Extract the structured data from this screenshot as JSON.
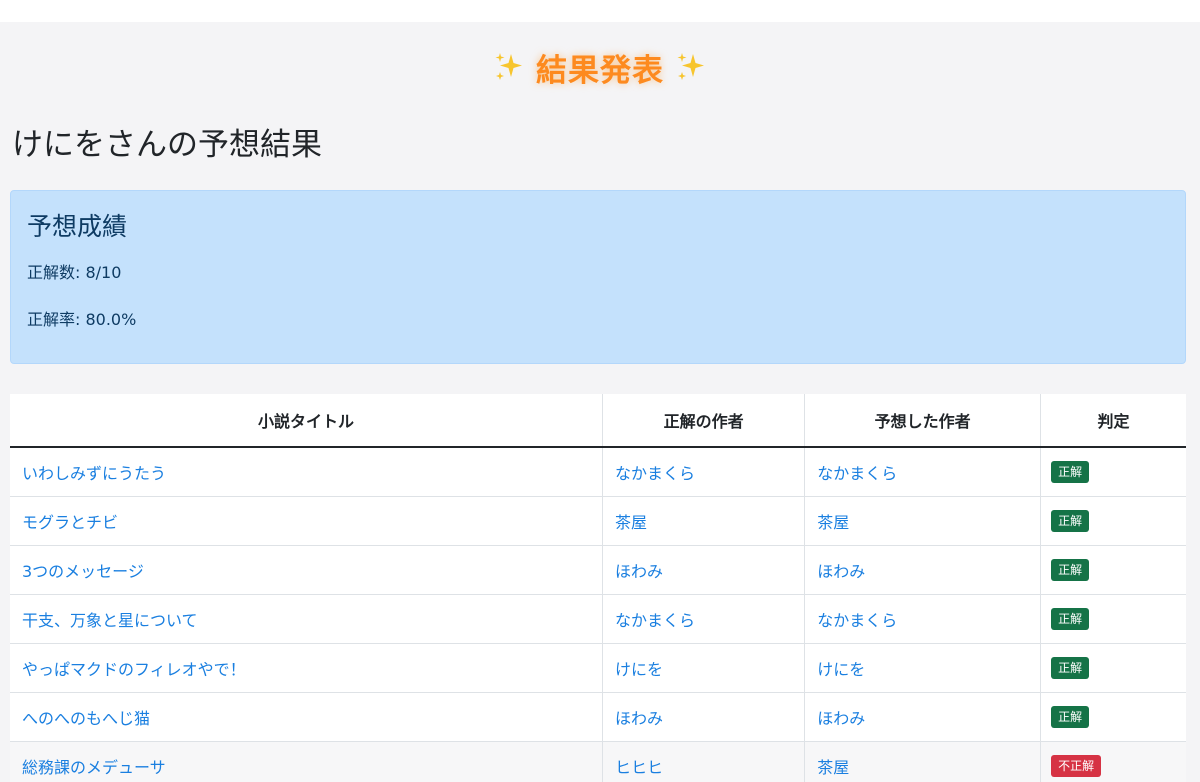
{
  "banner": {
    "title": "結果発表",
    "sparkle_icon": "sparkles-icon",
    "title_color": "#fd8a1f"
  },
  "user_heading": "けにをさんの予想結果",
  "score": {
    "title": "予想成績",
    "correct_label": "正解数: 8/10",
    "rate_label": "正解率: 80.0%",
    "background_color": "#c4e1fc"
  },
  "table": {
    "headers": {
      "title": "小説タイトル",
      "correct_author": "正解の作者",
      "guessed_author": "予想した作者",
      "judgement": "判定"
    },
    "rows": [
      {
        "title": "いわしみずにうたう",
        "correct_author": "なかまくら",
        "guessed_author": "なかまくら",
        "judgement": "正解",
        "status": "ok"
      },
      {
        "title": "モグラとチビ",
        "correct_author": "茶屋",
        "guessed_author": "茶屋",
        "judgement": "正解",
        "status": "ok"
      },
      {
        "title": "3つのメッセージ",
        "correct_author": "ほわみ",
        "guessed_author": "ほわみ",
        "judgement": "正解",
        "status": "ok"
      },
      {
        "title": "干支、万象と星について",
        "correct_author": "なかまくら",
        "guessed_author": "なかまくら",
        "judgement": "正解",
        "status": "ok"
      },
      {
        "title": "やっぱマクドのフィレオやで！",
        "correct_author": "けにを",
        "guessed_author": "けにを",
        "judgement": "正解",
        "status": "ok"
      },
      {
        "title": "へのへのもへじ猫",
        "correct_author": "ほわみ",
        "guessed_author": "ほわみ",
        "judgement": "正解",
        "status": "ok"
      },
      {
        "title": "総務課のメデューサ",
        "correct_author": "ヒヒヒ",
        "guessed_author": "茶屋",
        "judgement": "不正解",
        "status": "ng"
      }
    ],
    "colors": {
      "link": "#1a7fe0",
      "correct_badge": "#157347",
      "incorrect_badge": "#d63344"
    }
  }
}
